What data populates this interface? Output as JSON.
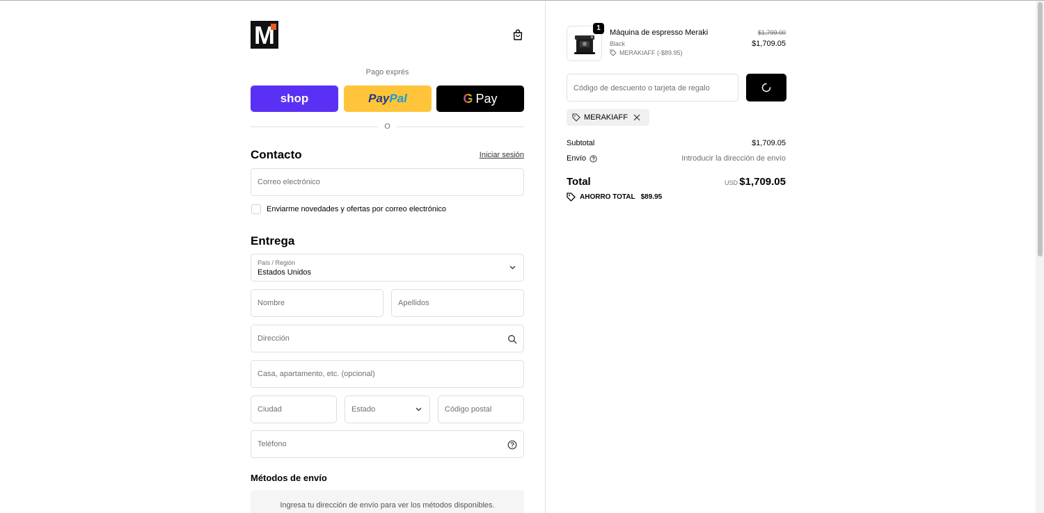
{
  "header": {
    "logo_letter": "M",
    "logo_icon": "brand-logo",
    "cart_icon": "shopping-bag-icon"
  },
  "express": {
    "label": "Pago exprés",
    "shop_label": "shop",
    "paypal_label_1": "Pay",
    "paypal_label_2": "Pal",
    "gpay_g": "G",
    "gpay_label": "Pay",
    "separator": "O"
  },
  "contact": {
    "title": "Contacto",
    "login_link": "Iniciar sesión",
    "email_placeholder": "Correo electrónico",
    "newsletter_label": "Enviarme novedades y ofertas por correo electrónico"
  },
  "delivery": {
    "title": "Entrega",
    "country_label": "País / Región",
    "country_value": "Estados Unidos",
    "first_name_placeholder": "Nombre",
    "last_name_placeholder": "Apellidos",
    "address_placeholder": "Dirección",
    "apartment_placeholder": "Casa, apartamento, etc. (opcional)",
    "city_placeholder": "Ciudad",
    "state_placeholder": "Estado",
    "zip_placeholder": "Código postal",
    "phone_placeholder": "Teléfono"
  },
  "shipping_methods": {
    "title": "Métodos de envío",
    "message": "Ingresa tu dirección de envío para ver los métodos disponibles."
  },
  "order": {
    "product_name": "Máquina de espresso Meraki",
    "variant": "Black",
    "discount_applied": "MERAKIAFF (-$89.95)",
    "quantity": "1",
    "price_original": "$1,799.00",
    "price_final": "$1,709.05",
    "discount_placeholder": "Código de descuento o tarjeta de regalo",
    "code_chip": "MERAKIAFF",
    "subtotal_label": "Subtotal",
    "subtotal_value": "$1,709.05",
    "shipping_label": "Envío",
    "shipping_value": "Introducir la dirección de envío",
    "total_label": "Total",
    "currency": "USD",
    "total_value": "$1,709.05",
    "savings_label": "AHORRO TOTAL",
    "savings_value": "$89.95"
  },
  "colors": {
    "shop_pay": "#5a31f4",
    "paypal": "#ffc439",
    "gpay": "#000000"
  }
}
